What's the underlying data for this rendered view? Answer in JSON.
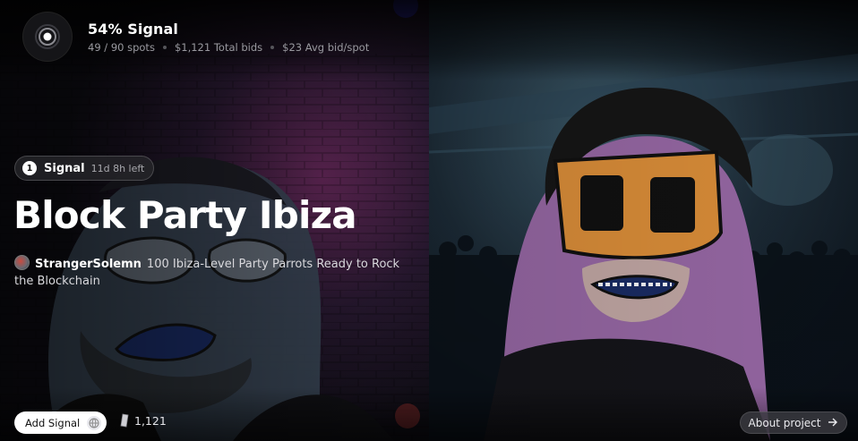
{
  "signal": {
    "title": "54% Signal",
    "spots": "49 / 90 spots",
    "total_bids": "$1,121 Total bids",
    "avg_bid": "$23 Avg bid/spot"
  },
  "status": {
    "number": "1",
    "label": "Signal",
    "time_left": "11d 8h left"
  },
  "project": {
    "title": "Block Party Ibiza",
    "author": "StrangerSolemn",
    "description": "100 Ibiza-Level Party Parrots Ready to Rock the Blockchain"
  },
  "actions": {
    "add_signal": "Add Signal",
    "bid_count": "1,121",
    "about_project": "About project"
  },
  "icons": {
    "signal": "signal-target-icon",
    "add": "globe-icon",
    "bid": "coin-icon",
    "arrow": "arrow-right-icon"
  },
  "colors": {
    "accent": "#ffffff",
    "mask": "#e0913a",
    "character_skin": "#b27ab8"
  }
}
